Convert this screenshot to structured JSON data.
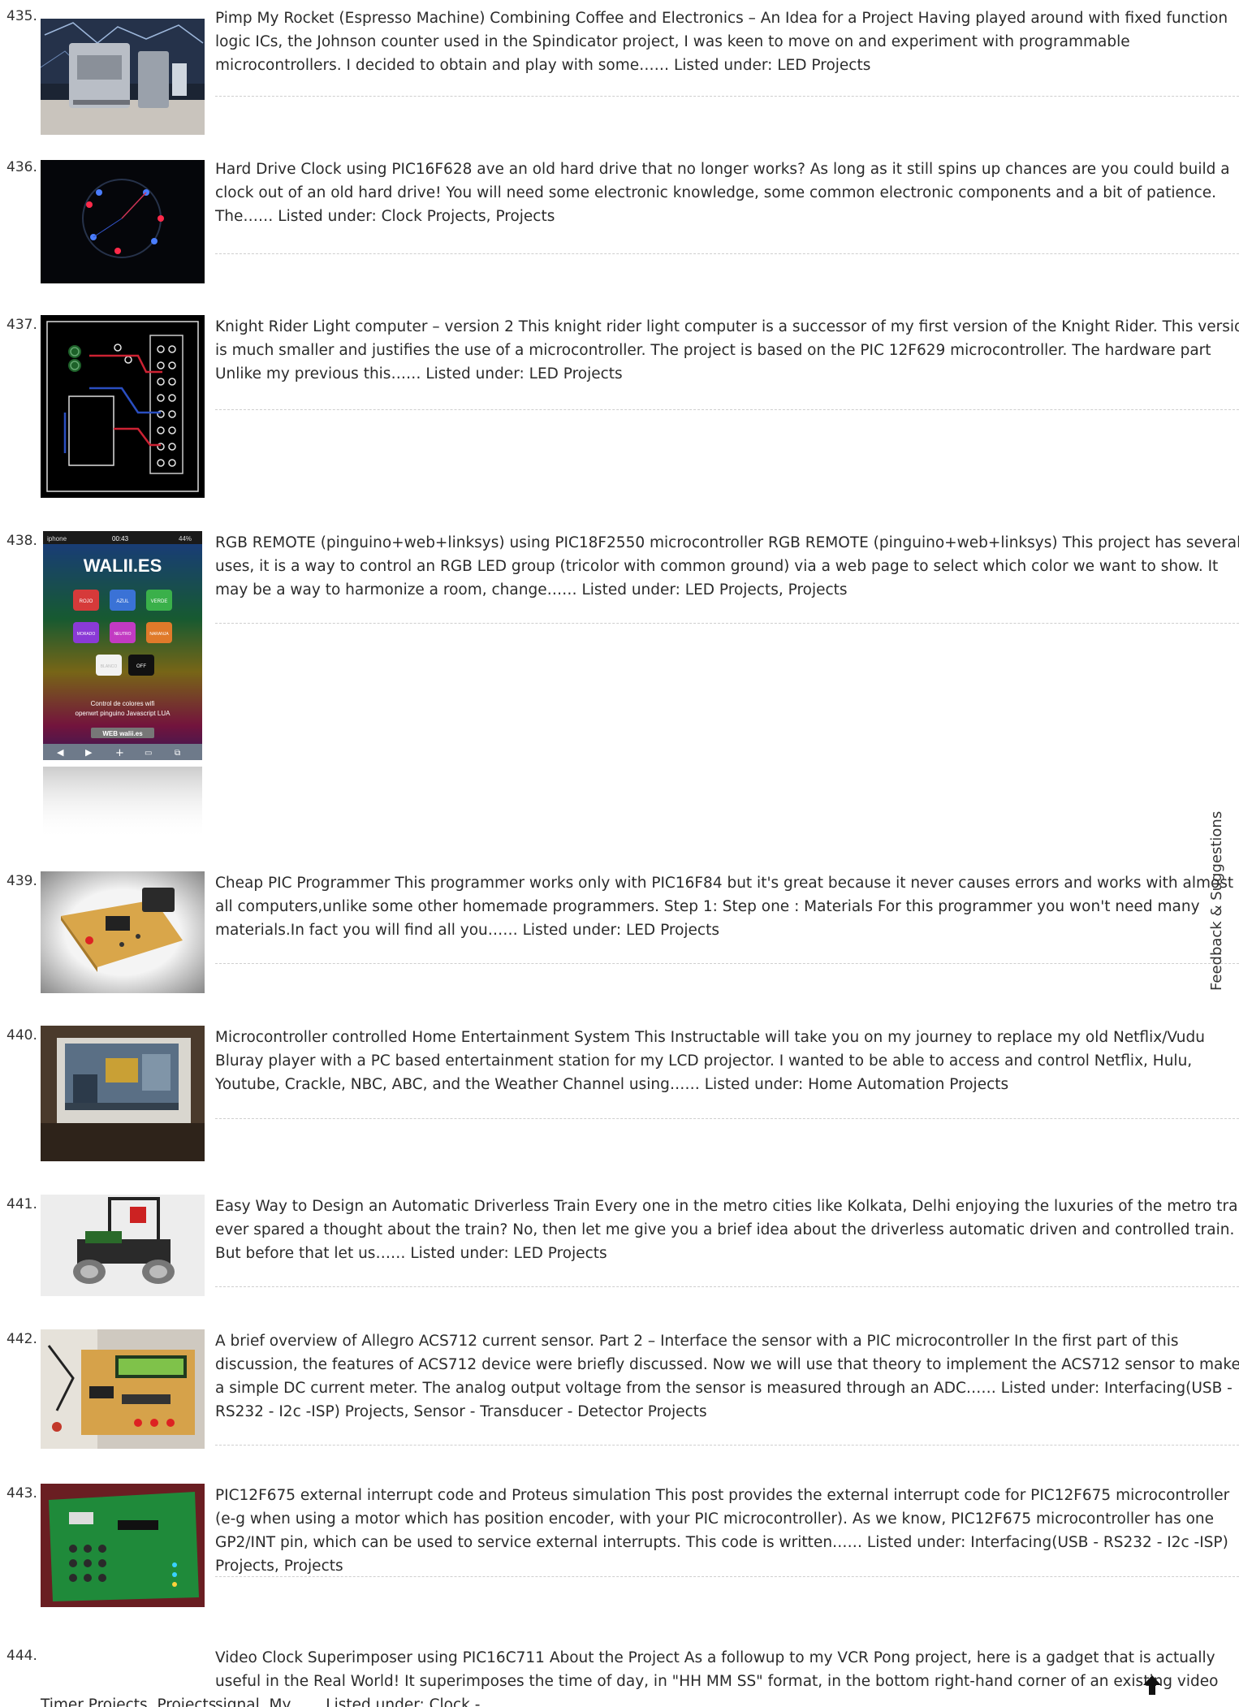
{
  "items": [
    {
      "number": "435.",
      "text": "Pimp My Rocket (Espresso Machine) Combining Coffee and Electronics – An Idea for a Project Having played around with fixed function logic ICs, the Johnson counter used in the Spindicator project, I was keen to move on and experiment with programmable microcontrollers. I decided to obtain and play with some…… Listed under: LED Projects",
      "image_alt": "espresso-machine-photo"
    },
    {
      "number": "436.",
      "text": "Hard Drive Clock using PIC16F628 ave an old hard drive that no longer works? As long as it still spins up chances are you could build a clock out of an old hard drive! You will need some electronic knowledge, some common electronic components and a bit of patience. The…… Listed under: Clock Projects, Projects",
      "image_alt": "hard-drive-clock-photo"
    },
    {
      "number": "437.",
      "text": "Knight Rider Light computer – version 2 This knight rider light computer is a successor of my first version of the Knight Rider. This version is much smaller and justifies the use of a microcontroller. The project is based on the PIC 12F629 microcontroller. The hardware part Unlike my previous this…… Listed under: LED Projects",
      "image_alt": "pcb-layout-image"
    },
    {
      "number": "438.",
      "text": "RGB REMOTE (pinguino+web+linksys) using PIC18F2550 microcontroller RGB REMOTE (pinguino+web+linksys) This project has several uses, it is a way to control an RGB LED group (tricolor with common ground) via a web page to select which color we want to show. It may be a way to harmonize a room, change…… Listed under: LED Projects, Projects",
      "image_alt": "phone-screenshot",
      "phone": {
        "carrier": "iphone",
        "time": "00:43",
        "battery": "44%",
        "brand": "WALII.ES",
        "buttons": [
          "ROJO",
          "AZUL",
          "VERDE",
          "MORADO",
          "NEUTRO",
          "NARANJA",
          "BLANCO",
          "OFF"
        ],
        "caption1": "Control de colores wifi",
        "caption2": "openwrt pinguino Javascript LUA",
        "web": "WEB walii.es"
      }
    },
    {
      "number": "439.",
      "text": "Cheap PIC Programmer This programmer works only with PIC16F84 but it's great because it never causes errors and works with almost all computers,unlike some other homemade programmers. Step 1: Step one : Materials For this programmer you won't need many materials.In fact you will find all you…… Listed under: LED Projects",
      "image_alt": "programmer-board-photo"
    },
    {
      "number": "440.",
      "text": "Microcontroller controlled Home Entertainment System This Instructable will take you on my journey to replace my old Netflix/Vudu Bluray player with a PC based entertainment station for my LCD projector. I wanted to be able to access and control Netflix, Hulu, Youtube, Crackle, NBC, ABC, and the Weather Channel using…… Listed under: Home Automation Projects",
      "image_alt": "projector-screen-photo"
    },
    {
      "number": "441.",
      "text": "Easy Way to Design an Automatic Driverless Train Every one in the metro cities like Kolkata, Delhi enjoying the luxuries of the metro train ever spared a thought about the train? No, then let me give you a brief idea about the driverless automatic driven and controlled train. But before that let us…… Listed under: LED Projects",
      "image_alt": "robot-car-photo"
    },
    {
      "number": "442.",
      "text": "A brief overview of Allegro ACS712 current sensor. Part 2 – Interface the sensor with a PIC microcontroller In the first part of this discussion, the features of ACS712 device were briefly discussed. Now we will use that theory to implement the ACS712 sensor to make a simple DC current meter. The analog output voltage from the sensor is measured through an ADC…… Listed under: Interfacing(USB - RS232 - I2c -ISP) Projects, Sensor - Transducer - Detector Projects",
      "image_alt": "lcd-board-photo"
    },
    {
      "number": "443.",
      "text": "PIC12F675 external interrupt code and Proteus simulation This post provides the external interrupt code for PIC12F675 microcontroller (e-g when using a motor which has position encoder, with your PIC microcontroller). As we know, PIC12F675 microcontroller has one GP2/INT pin, which can be used to service external interrupts. This code is written…… Listed under: Interfacing(USB - RS232 - I2c -ISP) Projects, Projects",
      "image_alt": "green-keypad-board-photo"
    },
    {
      "number": "444.",
      "text": "Video Clock Superimposer using PIC16C711 About the Project As a followup to my VCR Pong project, here is a gadget that is actually useful in the Real World! It superimposes the time of day, in \"HH MM SS\" format, in the bottom right-hand corner of an existing video signal. My…… Listed under: Clock -",
      "overflow_line": "Timer Projects, Projects"
    }
  ],
  "feedback_label": "Feedback & Suggestions",
  "icons": {
    "scroll_top": "arrow-up-icon"
  }
}
